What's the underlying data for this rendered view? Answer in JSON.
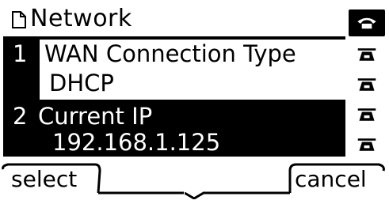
{
  "header": {
    "title": "Network",
    "icon": "document-icon"
  },
  "list": {
    "items": [
      {
        "number": "1",
        "label": "WAN Connection Type",
        "value": "DHCP",
        "selected": true
      },
      {
        "number": "2",
        "label": "Current IP",
        "value": "192.168.1.125",
        "selected": false
      }
    ]
  },
  "line_keys": {
    "icons": [
      "phone-handset-icon",
      "phone-line-icon",
      "phone-line-icon",
      "phone-line-icon",
      "phone-line-icon"
    ],
    "active_index": 0
  },
  "softkeys": {
    "left_label": "select",
    "middle_label": "",
    "middle_indicator": "down-arrow-icon",
    "right_label": "cancel"
  },
  "colors": {
    "background": "#ffffff",
    "foreground": "#000000"
  }
}
